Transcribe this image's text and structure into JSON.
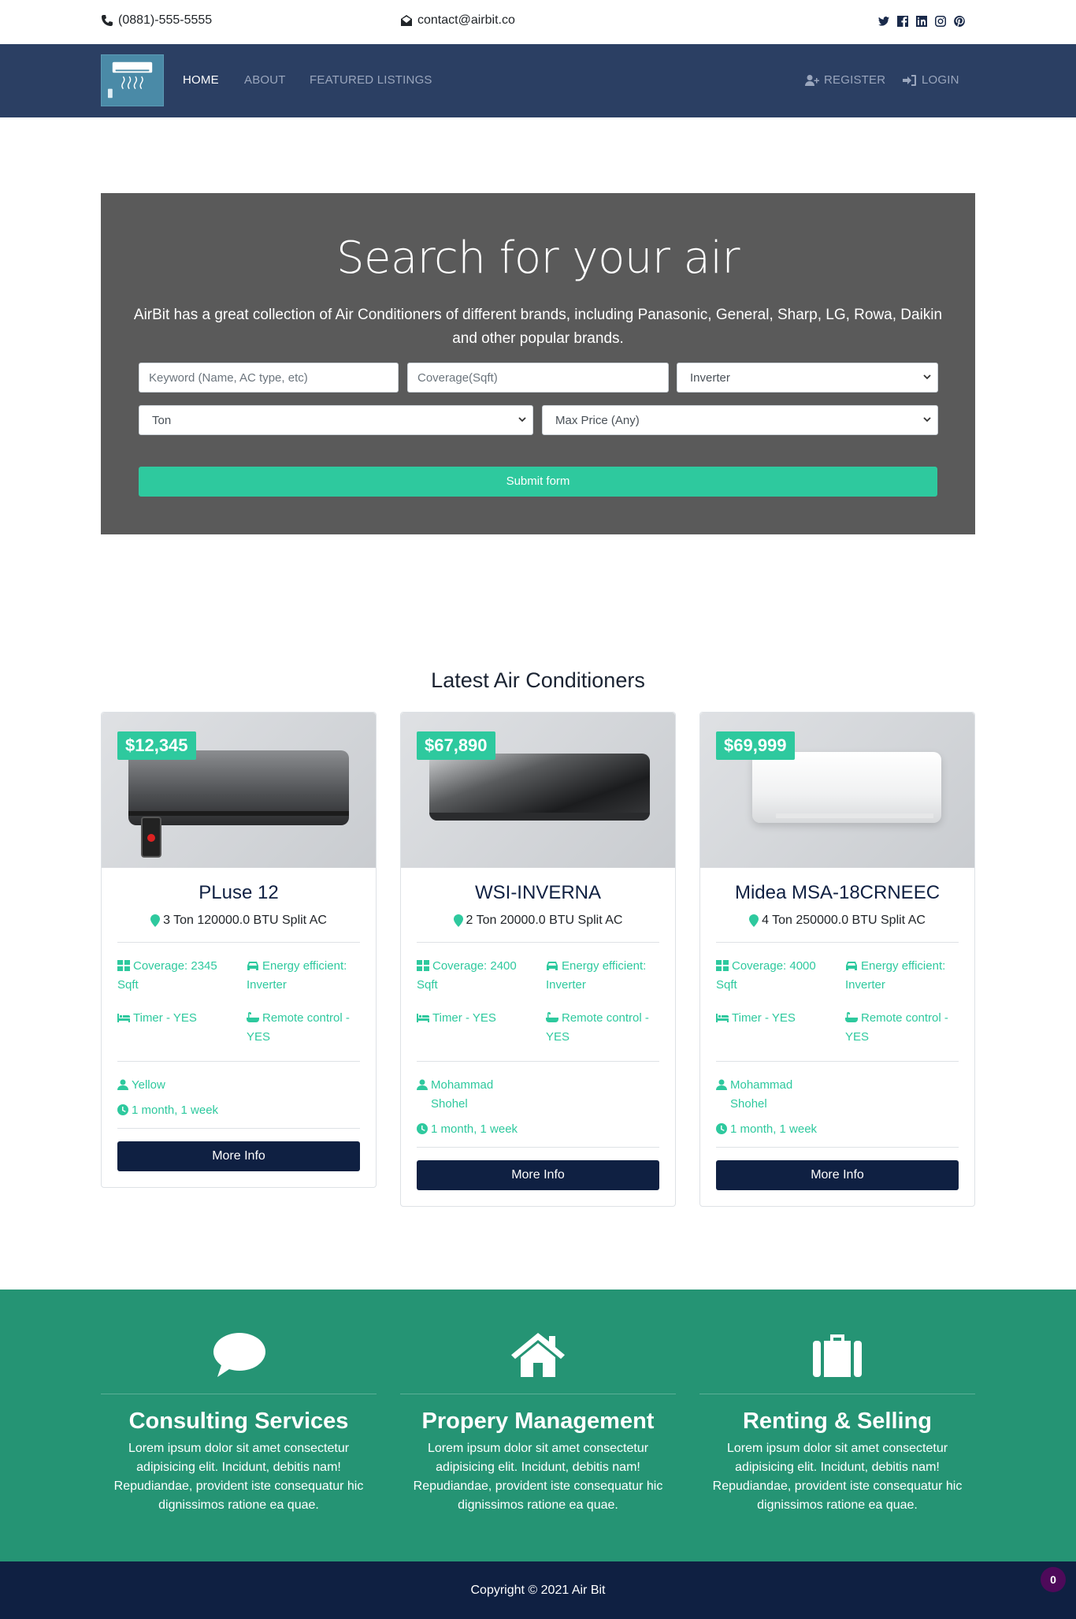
{
  "topbar": {
    "phone": "(0881)-555-5555",
    "email": "contact@airbit.co",
    "social_icons": [
      "twitter-icon",
      "facebook-icon",
      "linkedin-icon",
      "instagram-icon",
      "pinterest-icon"
    ]
  },
  "nav": {
    "links": [
      "HOME",
      "ABOUT",
      "FEATURED LISTINGS"
    ],
    "register": "REGISTER",
    "login": "LOGIN"
  },
  "showcase": {
    "title": "Search for your air",
    "text": "AirBit has a great collection of Air Conditioners of different brands, including Panasonic, General, Sharp, LG, Rowa, Daikin and other popular brands.",
    "keyword_placeholder": "Keyword (Name, AC type, etc)",
    "coverage_placeholder": "Coverage(Sqft)",
    "inverter_value": "Inverter",
    "ton_value": "Ton",
    "max_price_value": "Max Price (Any)",
    "submit_label": "Submit form"
  },
  "listings": {
    "title": "Latest Air Conditioners",
    "items": [
      {
        "price": "$12,345",
        "name": "PLuse 12",
        "subtitle": "3 Ton 120000.0 BTU Split AC",
        "coverage": "Coverage: 2345 Sqft",
        "energy": "Energy efficient: Inverter",
        "timer": "Timer - YES",
        "remote": "Remote control - YES",
        "seller": "Yellow",
        "listed": "1 month, 1 week",
        "button": "More Info"
      },
      {
        "price": "$67,890",
        "name": "WSI-INVERNA",
        "subtitle": "2 Ton 20000.0 BTU Split AC",
        "coverage": "Coverage: 2400 Sqft",
        "energy": "Energy efficient: Inverter",
        "timer": "Timer - YES",
        "remote": "Remote control - YES",
        "seller": "Mohammad Shohel",
        "listed": "1 month, 1 week",
        "button": "More Info"
      },
      {
        "price": "$69,999",
        "name": "Midea MSA-18CRNEEC",
        "subtitle": "4 Ton 250000.0 BTU Split AC",
        "coverage": "Coverage: 4000 Sqft",
        "energy": "Energy efficient: Inverter",
        "timer": "Timer - YES",
        "remote": "Remote control - YES",
        "seller": "Mohammad Shohel",
        "listed": "1 month, 1 week",
        "button": "More Info"
      }
    ]
  },
  "services": [
    {
      "icon": "comment-icon",
      "title": "Consulting Services",
      "text": "Lorem ipsum dolor sit amet consectetur adipisicing elit. Incidunt, debitis nam! Repudiandae, provident iste consequatur hic dignissimos ratione ea quae."
    },
    {
      "icon": "home-icon",
      "title": "Propery Management",
      "text": "Lorem ipsum dolor sit amet consectetur adipisicing elit. Incidunt, debitis nam! Repudiandae, provident iste consequatur hic dignissimos ratione ea quae."
    },
    {
      "icon": "suitcase-icon",
      "title": "Renting & Selling",
      "text": "Lorem ipsum dolor sit amet consectetur adipisicing elit. Incidunt, debitis nam! Repudiandae, provident iste consequatur hic dignissimos ratione ea quae."
    }
  ],
  "footer": {
    "copyright": "Copyright © 2021 Air Bit",
    "badge_count": "0"
  },
  "colors": {
    "nav_bg": "#2b3f63",
    "accent": "#2ec99e",
    "services_bg": "#259474",
    "footer_bg": "#0f2042",
    "showcase_bg": "#5a5a5a"
  }
}
